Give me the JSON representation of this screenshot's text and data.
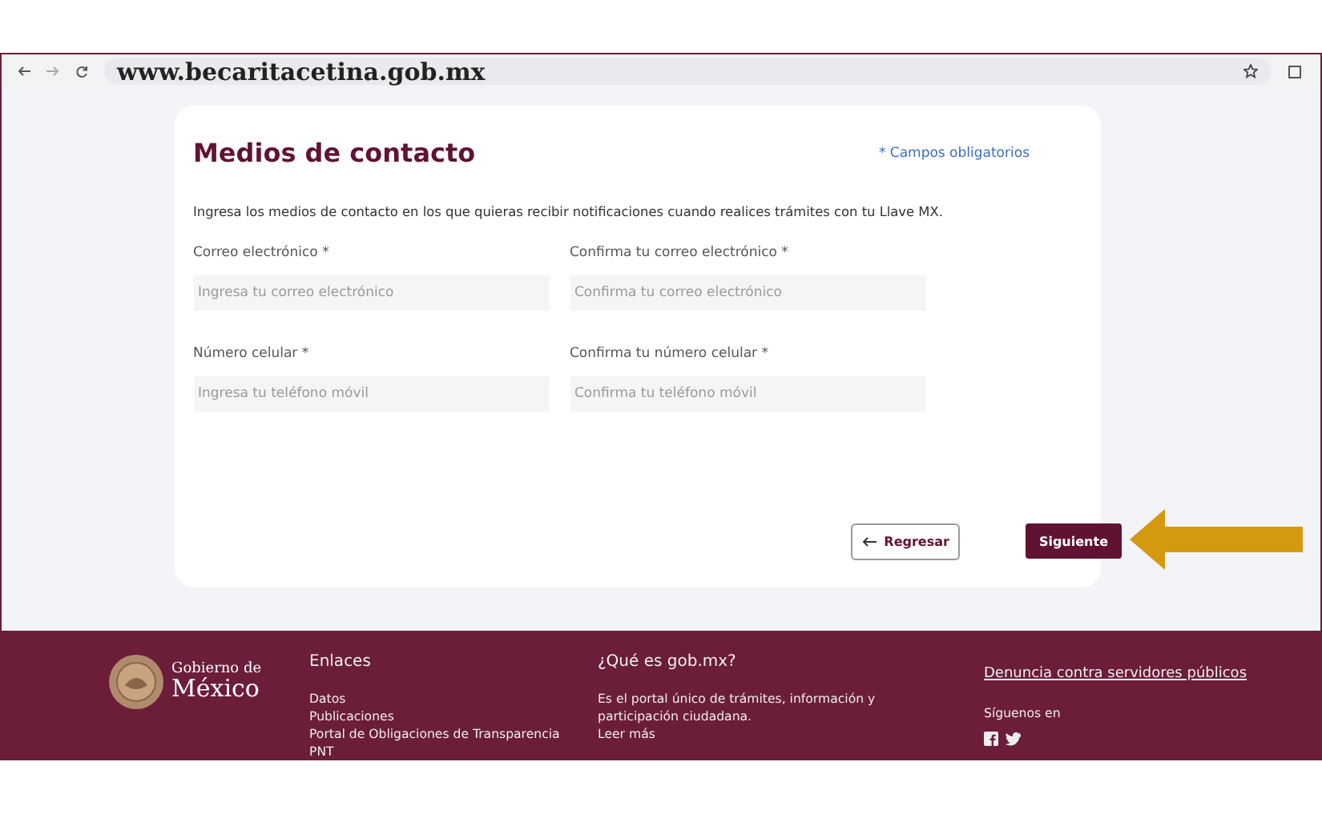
{
  "browser": {
    "url": "www.becaritacetina.gob.mx"
  },
  "form": {
    "title": "Medios de contacto",
    "required_note": "* Campos obligatorios",
    "intro": "Ingresa los medios de contacto en los que quieras recibir notificaciones cuando realices trámites con tu Llave MX.",
    "fields": [
      {
        "label": "Correo electrónico *",
        "placeholder": "Ingresa tu correo electrónico"
      },
      {
        "label": "Confirma tu correo electrónico *",
        "placeholder": "Confirma tu correo electrónico"
      },
      {
        "label": "Número celular *",
        "placeholder": "Ingresa tu teléfono móvil"
      },
      {
        "label": "Confirma tu número celular *",
        "placeholder": "Confirma tu teléfono móvil"
      }
    ],
    "back_button": "Regresar",
    "next_button": "Siguiente"
  },
  "footer": {
    "logo_top": "Gobierno de",
    "logo_bottom": "México",
    "links_title": "Enlaces",
    "links": [
      "Datos",
      "Publicaciones",
      "Portal de Obligaciones de Transparencia",
      "PNT"
    ],
    "about_title": "¿Qué es gob.mx?",
    "about_text": "Es el portal único de trámites, información y participación ciudadana.",
    "read_more": "Leer más",
    "report_link": "Denuncia contra servidores públicos",
    "follow": "Síguenos en"
  }
}
